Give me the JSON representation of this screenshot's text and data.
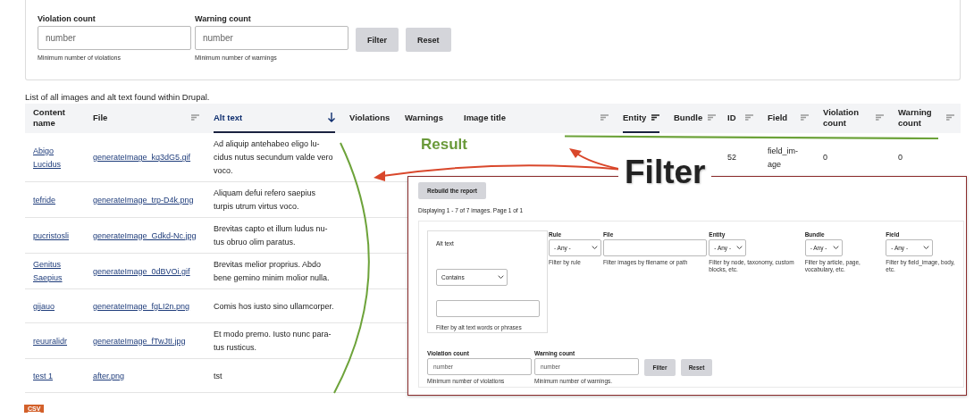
{
  "filter_form": {
    "fields": [
      {
        "label": "Violation count",
        "placeholder": "number",
        "hint": "Minimum number of violations"
      },
      {
        "label": "Warning count",
        "placeholder": "number",
        "hint": "Minimum number of warnings"
      }
    ],
    "buttons": [
      "Filter",
      "Reset"
    ]
  },
  "caption": "List of all images and alt text found within Drupal.",
  "table": {
    "columns": [
      {
        "label": "Content name",
        "kind": "plain",
        "selected": false
      },
      {
        "label": "File",
        "kind": "sortable",
        "selected": false
      },
      {
        "label": "Alt text",
        "kind": "sorted",
        "selected": true
      },
      {
        "label": "Violations",
        "kind": "plain",
        "selected": false
      },
      {
        "label": "Warnings",
        "kind": "plain",
        "selected": false
      },
      {
        "label": "Image title",
        "kind": "sortable",
        "selected": false
      },
      {
        "label": "Entity",
        "kind": "sortable",
        "selected": true
      },
      {
        "label": "Bundle",
        "kind": "sortable",
        "selected": false
      },
      {
        "label": "ID",
        "kind": "sortable",
        "selected": false
      },
      {
        "label": "Field",
        "kind": "sortable",
        "selected": false
      },
      {
        "label": "Violation count",
        "kind": "sortable",
        "selected": false
      },
      {
        "label": "Warning count",
        "kind": "sortable",
        "selected": false
      }
    ],
    "rows": [
      {
        "content_name": "Abigo Lucidus",
        "file": "generateImage_kq3dG5.gif",
        "alt_text": "Ad aliquip antehabeo eligo lu-cidus nutus secundum valde vero voco.",
        "id": "52",
        "field": "field_im-age",
        "violation_count": "0",
        "warning_count": "0"
      },
      {
        "content_name": "tefride",
        "file": "generateImage_trp-D4k.png",
        "alt_text": "Aliquam defui refero saepius turpis utrum virtus voco."
      },
      {
        "content_name": "pucristosli",
        "file": "generateImage_Gdkd-Nc.jpg",
        "alt_text": "Brevitas capto et illum ludus nu-tus obruo olim paratus."
      },
      {
        "content_name": "Genitus Saepius",
        "file": "generateImage_0dBVOi.gif",
        "alt_text": "Brevitas melior proprius. Abdo bene gemino minim molior nulla."
      },
      {
        "content_name": "gijauo",
        "file": "generateImage_fgLI2n.png",
        "alt_text": "Comis hos iusto sino ullamcorper."
      },
      {
        "content_name": "reuuralidr",
        "file": "generateImage_fTwJtI.jpg",
        "alt_text": "Et modo premo. Iusto nunc para-tus rusticus."
      },
      {
        "content_name": "test 1",
        "file": "after.png",
        "alt_text": "tst"
      }
    ]
  },
  "export_link": "CSV",
  "inset": {
    "button": "Rebuild the report",
    "summary": "Displaying 1 - 7 of 7 images. Page 1 of 1",
    "alt_text_filter": {
      "label": "Alt text",
      "operator": "Contains",
      "hint": "Filter by alt text words or phrases"
    },
    "filters": [
      {
        "kind": "select",
        "label": "Rule",
        "value": "- Any -",
        "hint": "Filter by rule"
      },
      {
        "kind": "text",
        "label": "File",
        "hint": "Filter images by filename or path"
      },
      {
        "kind": "select",
        "label": "Entity",
        "value": "- Any -",
        "hint": "Filter by node, taxonomy, custom blocks, etc."
      },
      {
        "kind": "select",
        "label": "Bundle",
        "value": "- Any -",
        "hint": "Filter by article, page, vocabulary, etc."
      },
      {
        "kind": "select",
        "label": "Field",
        "value": "- Any -",
        "hint": "Filter by field_image, body, etc."
      }
    ],
    "count_fields": [
      {
        "label": "Violation count",
        "placeholder": "number",
        "hint": "Minimum number of violations"
      },
      {
        "label": "Warning count",
        "placeholder": "number",
        "hint": "Minimum number of warnings."
      }
    ],
    "buttons": [
      "Filter",
      "Reset"
    ]
  },
  "annotations": {
    "result": "Result",
    "filter": "Filter"
  }
}
